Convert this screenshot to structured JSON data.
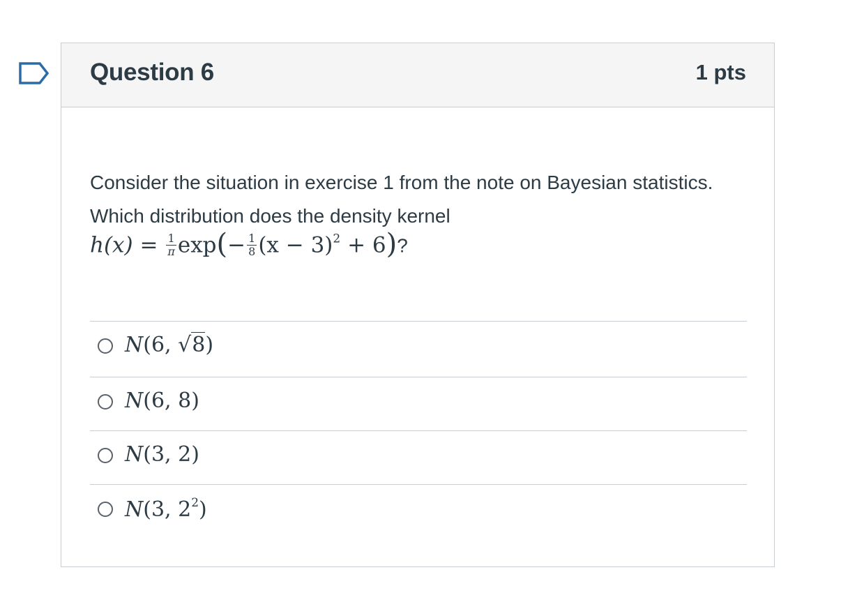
{
  "question": {
    "name": "Question 6",
    "points": "1 pts",
    "text": "Consider the situation in exercise 1 from the note on Bayesian statistics. Which distribution does the density kernel",
    "formula": {
      "lhs": "h(x) =",
      "frac1_num": "1",
      "frac1_den": "π",
      "func": "exp",
      "frac2_num": "1",
      "frac2_den": "8",
      "inner": "(x − 3)",
      "exponent": "2",
      "tail": "+ 6",
      "end": "?"
    }
  },
  "answers": [
    {
      "prefix": "N(6, ",
      "radicand": "8",
      "suffix": ")"
    },
    {
      "label": "N(6, 8)"
    },
    {
      "label": "N(3, 2)"
    },
    {
      "prefix": "N(3, 2",
      "sup": "2",
      "suffix": ")"
    }
  ],
  "colors": {
    "flag": "#2d6ba8",
    "border": "#c7cdd1",
    "header_bg": "#f5f5f5",
    "text": "#2d3b45"
  }
}
